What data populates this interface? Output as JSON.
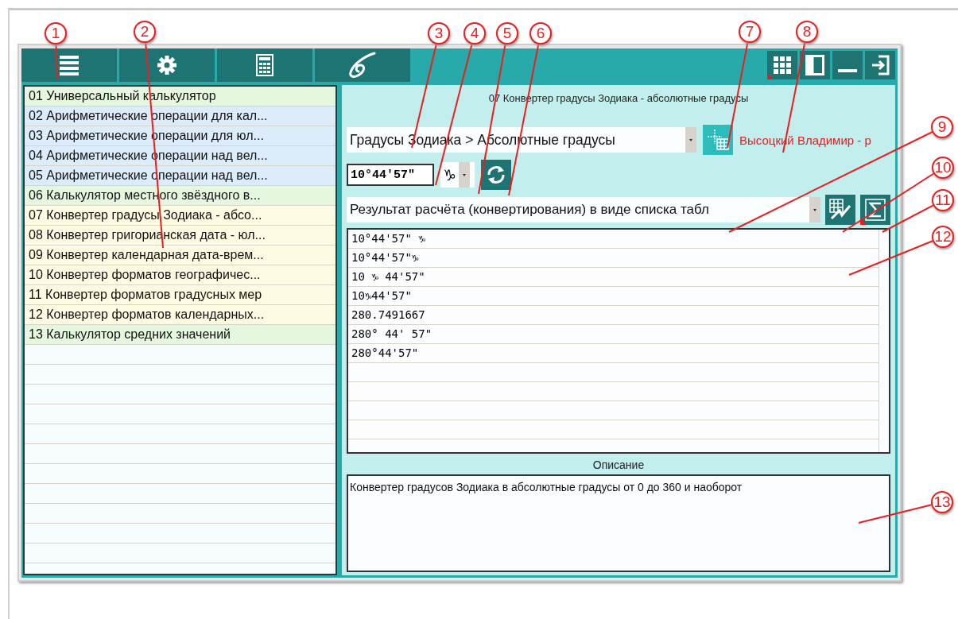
{
  "toolbar": {
    "left_buttons": [
      {
        "kind": "menu"
      },
      {
        "kind": "gear"
      },
      {
        "kind": "calculator"
      },
      {
        "kind": "spiral"
      }
    ],
    "right_buttons": [
      {
        "kind": "grid",
        "flag": true
      },
      {
        "kind": "panel",
        "flag": false
      },
      {
        "kind": "minimize",
        "flag": false
      },
      {
        "kind": "exit",
        "flag": false
      }
    ]
  },
  "calculator_list": {
    "items": [
      {
        "label": "01 Универсальный калькулятор",
        "color": "#e5f7de",
        "selected": false
      },
      {
        "label": "02 Арифметические операции для кал...",
        "color": "#dcecfa",
        "selected": false
      },
      {
        "label": "03 Арифметические операции для юл...",
        "color": "#dcecfa",
        "selected": false
      },
      {
        "label": "04 Арифметические операции над вел...",
        "color": "#dcecfa",
        "selected": false
      },
      {
        "label": "05 Арифметические операции над вел...",
        "color": "#dcecfa",
        "selected": false
      },
      {
        "label": "06 Калькулятор местного звёздного в...",
        "color": "#e5f7de",
        "selected": false
      },
      {
        "label": "07 Конвертер градусы Зодиака - абсо...",
        "color": "#fdfbe2",
        "selected": false
      },
      {
        "label": "08 Конвертер григорианская дата - юл...",
        "color": "#fdfbe2",
        "selected": false
      },
      {
        "label": "09 Конвертер календарная дата-врем...",
        "color": "#fdfbe2",
        "selected": false
      },
      {
        "label": "10 Конвертер форматов географичес...",
        "color": "#fdfbe2",
        "selected": false
      },
      {
        "label": "11 Конвертер форматов градусных мер",
        "color": "#fdfbe2",
        "selected": false
      },
      {
        "label": "12 Конвертер форматов календарных...",
        "color": "#fdfbe2",
        "selected": false
      },
      {
        "label": "13 Калькулятор средних значений",
        "color": "#e5f7de",
        "selected": false
      }
    ]
  },
  "panel": {
    "title": "07 Конвертер градусы Зодиака - абсолютные градусы",
    "mode_select": {
      "value": "Градусы Зодиака > Абсолютные градусы"
    },
    "author": "Высоцкий Владимир - р",
    "degree_input": {
      "value": "10°44'57\""
    },
    "sign_select": {
      "value": "♑"
    },
    "output_select": {
      "value": "Результат расчёта (конвертирования) в виде списка табл"
    },
    "results": [
      {
        "text": "10°44'57\" ♑"
      },
      {
        "text": "10°44'57\"♑"
      },
      {
        "text": "10 ♑ 44'57\""
      },
      {
        "text": "10♑44'57\""
      },
      {
        "text": "280.7491667"
      },
      {
        "text": "280° 44' 57\""
      },
      {
        "text": "280°44'57\""
      }
    ],
    "description_label": "Описание",
    "description": "Конвертер градусов Зодиака в абсолютные градусы от 0 до 360 и наоборот"
  },
  "callouts": [
    {
      "number": "1"
    },
    {
      "number": "2"
    },
    {
      "number": "3"
    },
    {
      "number": "4"
    },
    {
      "number": "5"
    },
    {
      "number": "6"
    },
    {
      "number": "7"
    },
    {
      "number": "8"
    },
    {
      "number": "9"
    },
    {
      "number": "10"
    },
    {
      "number": "11"
    },
    {
      "number": "12"
    },
    {
      "number": "13"
    }
  ]
}
